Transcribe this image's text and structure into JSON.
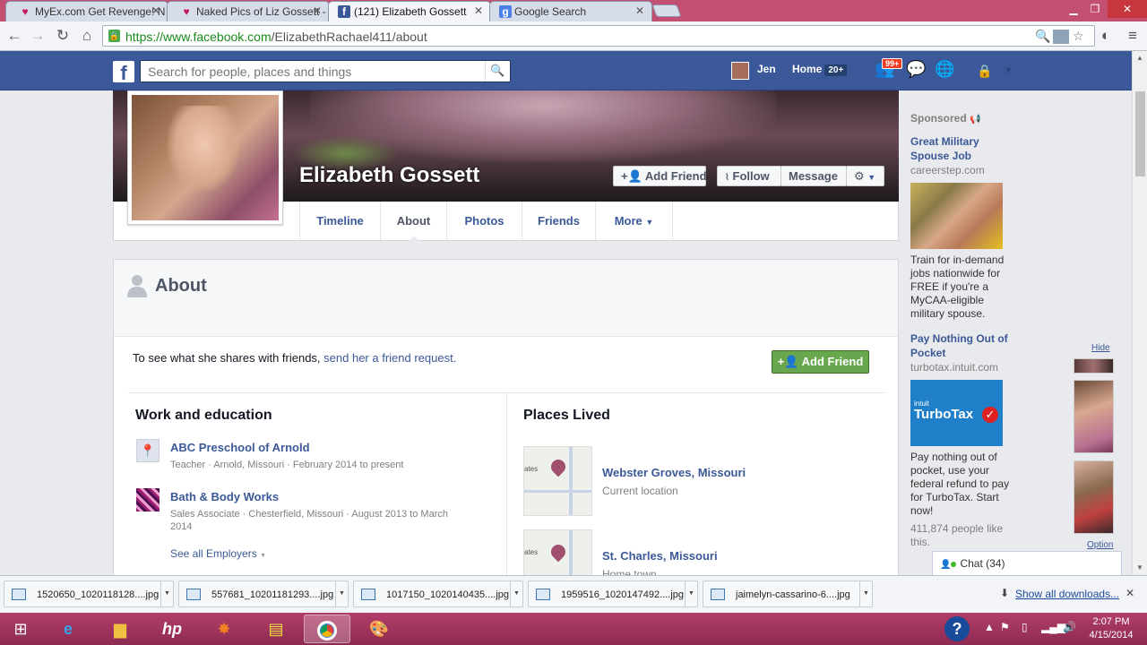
{
  "browser": {
    "tabs": [
      {
        "title": "MyEx.com Get Revenge! N",
        "icon": "heart-icon"
      },
      {
        "title": "Naked Pics of Liz Gossett -",
        "icon": "heart-icon"
      },
      {
        "title": "(121) Elizabeth Gossett",
        "icon": "facebook-icon"
      },
      {
        "title": "Google Search",
        "icon": "google-icon"
      }
    ],
    "url_host": "https://www.facebook.com",
    "url_path": "/ElizabethRachael411/about"
  },
  "fb": {
    "logo": "f",
    "search_placeholder": "Search for people, places and things",
    "user_name": "Jen",
    "home_label": "Home",
    "home_badge": "20+",
    "friend_requests_badge": "99+"
  },
  "profile": {
    "name": "Elizabeth Gossett",
    "add_friend": "Add Friend",
    "follow": "Follow",
    "message": "Message",
    "tabs": [
      "Timeline",
      "About",
      "Photos",
      "Friends",
      "More"
    ]
  },
  "about": {
    "title": "About",
    "request_text": "To see what she shares with friends, ",
    "request_link": "send her a friend request.",
    "add_friend": "Add Friend",
    "work_heading": "Work and education",
    "work": [
      {
        "name": "ABC Preschool of Arnold",
        "detail": "Teacher · Arnold, Missouri · February 2014 to present"
      },
      {
        "name": "Bath & Body Works",
        "detail": "Sales Associate · Chesterfield, Missouri · August 2013 to March 2014"
      }
    ],
    "see_all": "See all Employers",
    "places_heading": "Places Lived",
    "places": [
      {
        "name": "Webster Groves, Missouri",
        "detail": "Current location",
        "map_label": "ates"
      },
      {
        "name": "St. Charles, Missouri",
        "detail": "Home town",
        "map_label": "ates"
      }
    ]
  },
  "ads": {
    "sponsored": "Sponsored",
    "items": [
      {
        "title": "Great Military Spouse Job",
        "domain": "careerstep.com",
        "body": "Train for in-demand jobs nationwide for FREE if you're a MyCAA-eligible military spouse."
      },
      {
        "title": "Pay Nothing Out of Pocket",
        "domain": "turbotax.intuit.com",
        "brand_small": "intuit",
        "brand": "TurboTax",
        "body": "Pay nothing out of pocket, use your federal refund to pay for TurboTax. Start now!",
        "likes": "411,874 people like this."
      }
    ]
  },
  "chat": {
    "hide": "Hide",
    "option": "Option",
    "label": "Chat (34)"
  },
  "downloads": {
    "files": [
      "1520650_1020118128....jpg",
      "557681_10201181293....jpg",
      "1017150_1020140435....jpg",
      "1959516_1020147492....jpg",
      "jaimelyn-cassarino-6....jpg"
    ],
    "show_all": "Show all downloads..."
  },
  "taskbar": {
    "time": "2:07 PM",
    "date": "4/15/2014"
  }
}
